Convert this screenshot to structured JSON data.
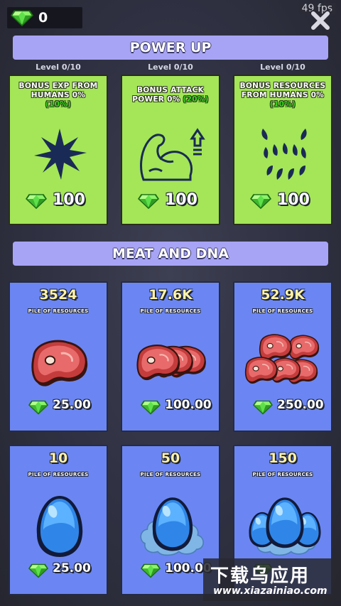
{
  "header": {
    "gem_count": "0",
    "fps": "49 fps"
  },
  "sections": {
    "power_up": "POWER UP",
    "meat_dna": "MEAT AND DNA"
  },
  "power_ups": [
    {
      "level": "Level 0/10",
      "title": "BONUS EXP FROM HUMANS 0%",
      "bonus": "(10%)",
      "price": "100",
      "icon": "burst-icon"
    },
    {
      "level": "Level 0/10",
      "title": "BONUS ATTACK POWER 0%",
      "bonus": "(20%)",
      "price": "100",
      "icon": "flexed-arm-icon"
    },
    {
      "level": "Level 0/10",
      "title": "BONUS RESOURCES FROM HUMANS 0%",
      "bonus": "(10%)",
      "price": "100",
      "icon": "monster-mouth-icon"
    }
  ],
  "resources": [
    {
      "amount": "3524",
      "subtitle": "PILE OF RESOURCES",
      "price": "25.00",
      "icon": "steak-icon"
    },
    {
      "amount": "17.6K",
      "subtitle": "PILE OF RESOURCES",
      "price": "100.00",
      "icon": "steak-stack-icon"
    },
    {
      "amount": "52.9K",
      "subtitle": "PILE OF RESOURCES",
      "price": "250.00",
      "icon": "steak-pile-icon"
    },
    {
      "amount": "10",
      "subtitle": "PILE OF RESOURCES",
      "price": "25.00",
      "icon": "dna-egg-icon"
    },
    {
      "amount": "50",
      "subtitle": "PILE OF RESOURCES",
      "price": "100.00",
      "icon": "dna-egg-cloud-icon"
    },
    {
      "amount": "150",
      "subtitle": "PILE OF RESOURCES",
      "price": "",
      "icon": "dna-egg-cluster-icon"
    }
  ],
  "watermark": {
    "cn": "下载乌应用",
    "url": "www.xiazainiao.com"
  },
  "colors": {
    "power_card": "#a4e657",
    "resource_card": "#6b86f2",
    "banner": "#a8a4f5",
    "bonus_pct": "#37d81b",
    "amount": "#fff2a8"
  }
}
